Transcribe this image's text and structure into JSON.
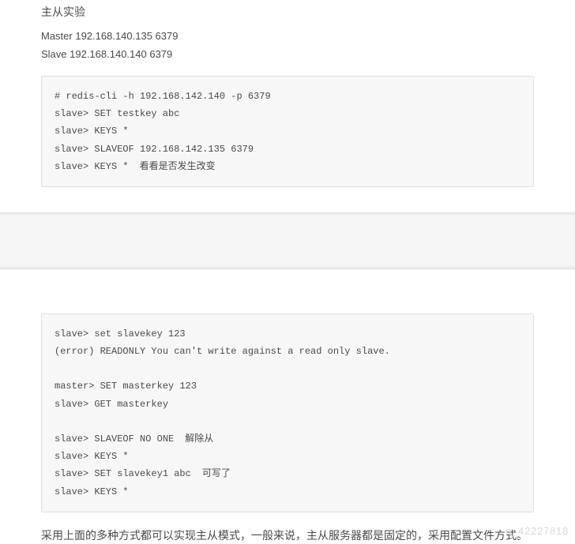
{
  "section1": {
    "heading": "主从实验",
    "masterLine": "Master 192.168.140.135   6379",
    "slaveLine": "Slave    192.168.140.140   6379",
    "code": {
      "l1": "# redis-cli -h 192.168.142.140 -p 6379",
      "l2": "slave> SET testkey abc",
      "l3": "slave> KEYS *",
      "l4": "slave> SLAVEOF 192.168.142.135 6379",
      "l5": "slave> KEYS *",
      "l5_annot": "看看是否发生改变"
    }
  },
  "section2": {
    "code": {
      "l1": "slave> set slavekey 123",
      "l2": "(error) READONLY You can't write against a read only slave.",
      "l3": "",
      "l4": "master> SET masterkey 123",
      "l5": "slave> GET masterkey",
      "l6": "",
      "l7": "slave> SLAVEOF NO ONE",
      "l7_annot": "解除从",
      "l8": "slave> KEYS *",
      "l9": "slave> SET slavekey1 abc",
      "l9_annot": "可写了",
      "l10": "slave> KEYS *"
    }
  },
  "conclusion": "采用上面的多种方式都可以实现主从模式，一般来说，主从服务器都是固定的，采用配置文件方式。",
  "watermark": "q_42227818"
}
